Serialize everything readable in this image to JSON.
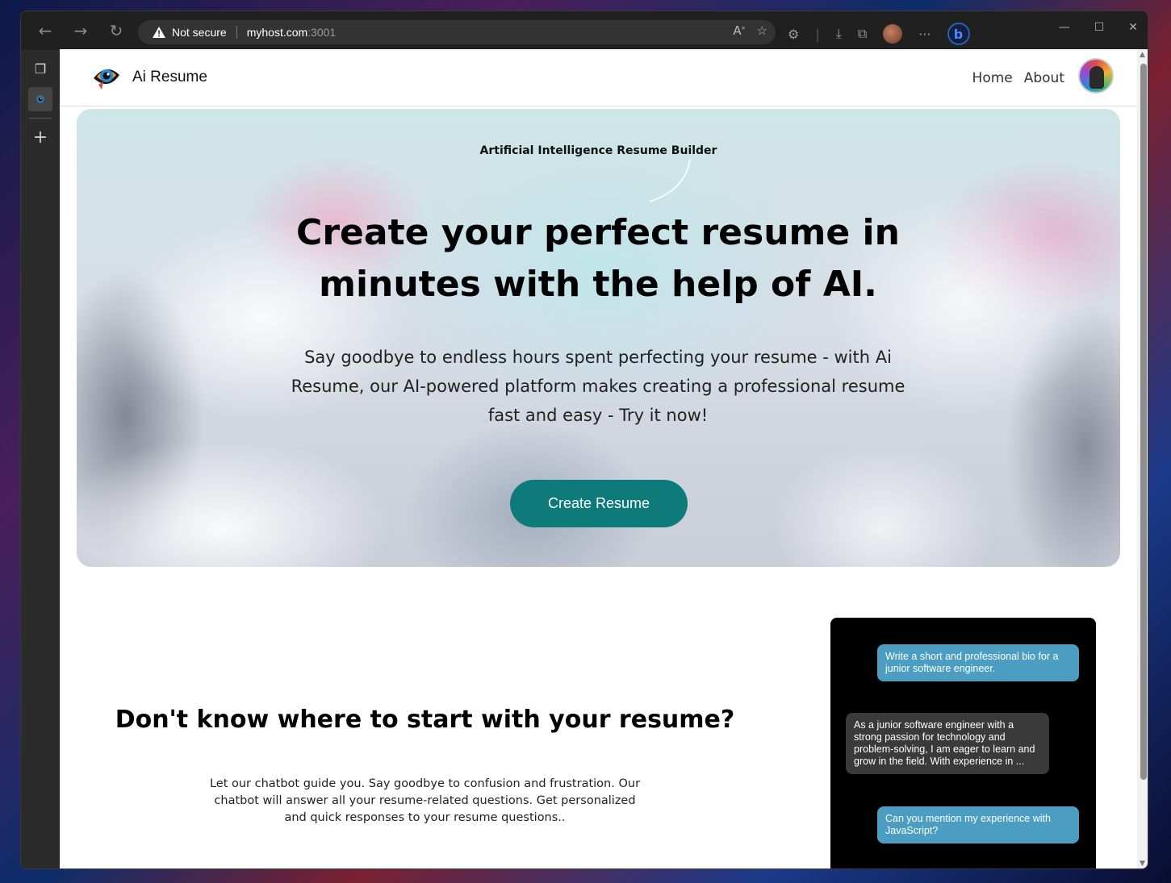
{
  "browser": {
    "security_label": "Not secure",
    "url_host": "myhost.com",
    "url_port": ":3001"
  },
  "site": {
    "brand": "Ai Resume",
    "nav": [
      "Home",
      "About"
    ]
  },
  "hero": {
    "tagline": "Artificial Intelligence Resume Builder",
    "title": "Create your perfect resume in minutes with the help of AI.",
    "description": "Say goodbye to endless hours spent perfecting your resume - with Ai Resume, our AI-powered platform makes creating a professional resume fast and easy - Try it now!",
    "cta_label": "Create Resume"
  },
  "chatbot_section": {
    "title": "Don't know where to start with your resume?",
    "description": "Let our chatbot guide you. Say goodbye to confusion and frustration. Our chatbot will answer all your resume-related questions. Get personalized and quick responses to your resume questions..",
    "messages": [
      {
        "role": "user",
        "text": "Write a short and professional bio for a junior software engineer."
      },
      {
        "role": "bot",
        "text": "As a junior software engineer with a strong passion for technology and problem-solving, I am eager to learn and grow in the field. With experience in ..."
      },
      {
        "role": "user",
        "text": "Can you mention my experience with JavaScript?"
      }
    ]
  },
  "colors": {
    "cta": "#0f7a7a",
    "user_bubble": "#4b9ec2",
    "bot_bubble": "#3a3a3a",
    "chat_bg": "#000000"
  }
}
